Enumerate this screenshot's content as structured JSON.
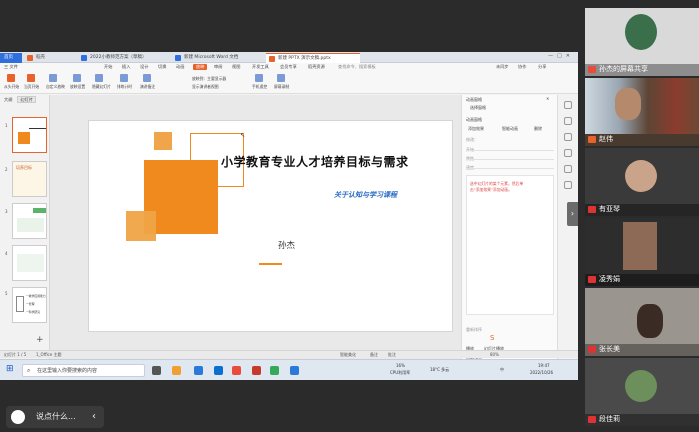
{
  "window": {
    "tabs": [
      {
        "label": "首页",
        "color": "#2f6fde"
      },
      {
        "label": "稻壳",
        "color": "#e8632b"
      },
      {
        "label": "2022小教师范方案（草稿）",
        "color": "#2f6fde"
      },
      {
        "label": "新建 Microsoft Word 文档",
        "color": "#2f6fde"
      },
      {
        "label": "新建 PPTX 演示文稿.pptx",
        "color": "#e8632b"
      }
    ]
  },
  "menu": {
    "items": [
      "三 文件",
      "开始",
      "插入",
      "设计",
      "切换",
      "动画",
      "放映",
      "审阅",
      "视图",
      "开发工具",
      "会员专享",
      "稻壳资源"
    ],
    "selected_index": 6,
    "search": "查找命令、搜索模板",
    "right": [
      "未同步",
      "协作",
      "分享"
    ]
  },
  "ribbon": {
    "buttons": [
      "从头开始",
      "当页开始",
      "自定义放映",
      "放映设置",
      "隐藏幻灯片",
      "排练计时",
      "演讲备注",
      "手机遥控",
      "屏幕录制"
    ],
    "options": [
      "放映到：主要显示器",
      "显示演讲者视图"
    ]
  },
  "left_pane": {
    "tab_outline": "大纲",
    "tab_slides": "幻灯片",
    "slide_numbers": [
      "1",
      "2",
      "3",
      "4",
      "5"
    ],
    "thumb2_title": "培养目标",
    "thumb5_lines": [
      "一教学应用能力",
      "一管理",
      "一科学研究"
    ]
  },
  "slide": {
    "title": "小学教育专业人才培养目标与需求",
    "subtitle": "关于认知与学习课程",
    "author": "孙杰"
  },
  "right_pane": {
    "header": "动画窗格",
    "select_pane": "选择窗格",
    "animation_pane": "动画窗格",
    "add_effect": "添加效果",
    "smart_animation": "智能动画",
    "delete": "删除",
    "modify": "修改：",
    "start": "开始",
    "property": "属性",
    "speed": "速度",
    "note": "选中幻灯片的某个元素，然后单击“添加效果”添加动画。",
    "reorder": "重新排序",
    "play": "播放",
    "slideshow": "幻灯片播放",
    "autopreview": "自动预览"
  },
  "status": {
    "slide_pos": "幻灯片 1 / 5",
    "theme": "1_Office 主题",
    "smart_beautify": "智能美化",
    "notes": "备注",
    "comments": "批注",
    "zoom": "80%"
  },
  "taskbar": {
    "search_placeholder": "在这里输入你要搜索的内容",
    "cpu_label": "16%",
    "cpu_sub": "CPU利用率",
    "weather": "18°C 多云",
    "lang": "中",
    "time": "19:47",
    "date": "2022/10/26",
    "app_colors": [
      "#f0a030",
      "#2b79d8",
      "#0b6fd1",
      "#e84c3d",
      "#c63a2b",
      "#36a85a",
      "#2b79d8"
    ]
  },
  "participants": [
    {
      "name": "孙杰的屏幕共享",
      "bg": "#d9d9d9"
    },
    {
      "name": "赵伟",
      "bg": "#6f5a48"
    },
    {
      "name": "有亚琴",
      "bg": "#3a3a3a"
    },
    {
      "name": "凌秀娟",
      "bg": "#2d2d2d"
    },
    {
      "name": "张长美",
      "bg": "#9b958f"
    },
    {
      "name": "段佳莉",
      "bg": "#4a4a4a"
    }
  ],
  "bottom": {
    "chat_placeholder": "说点什么..."
  }
}
